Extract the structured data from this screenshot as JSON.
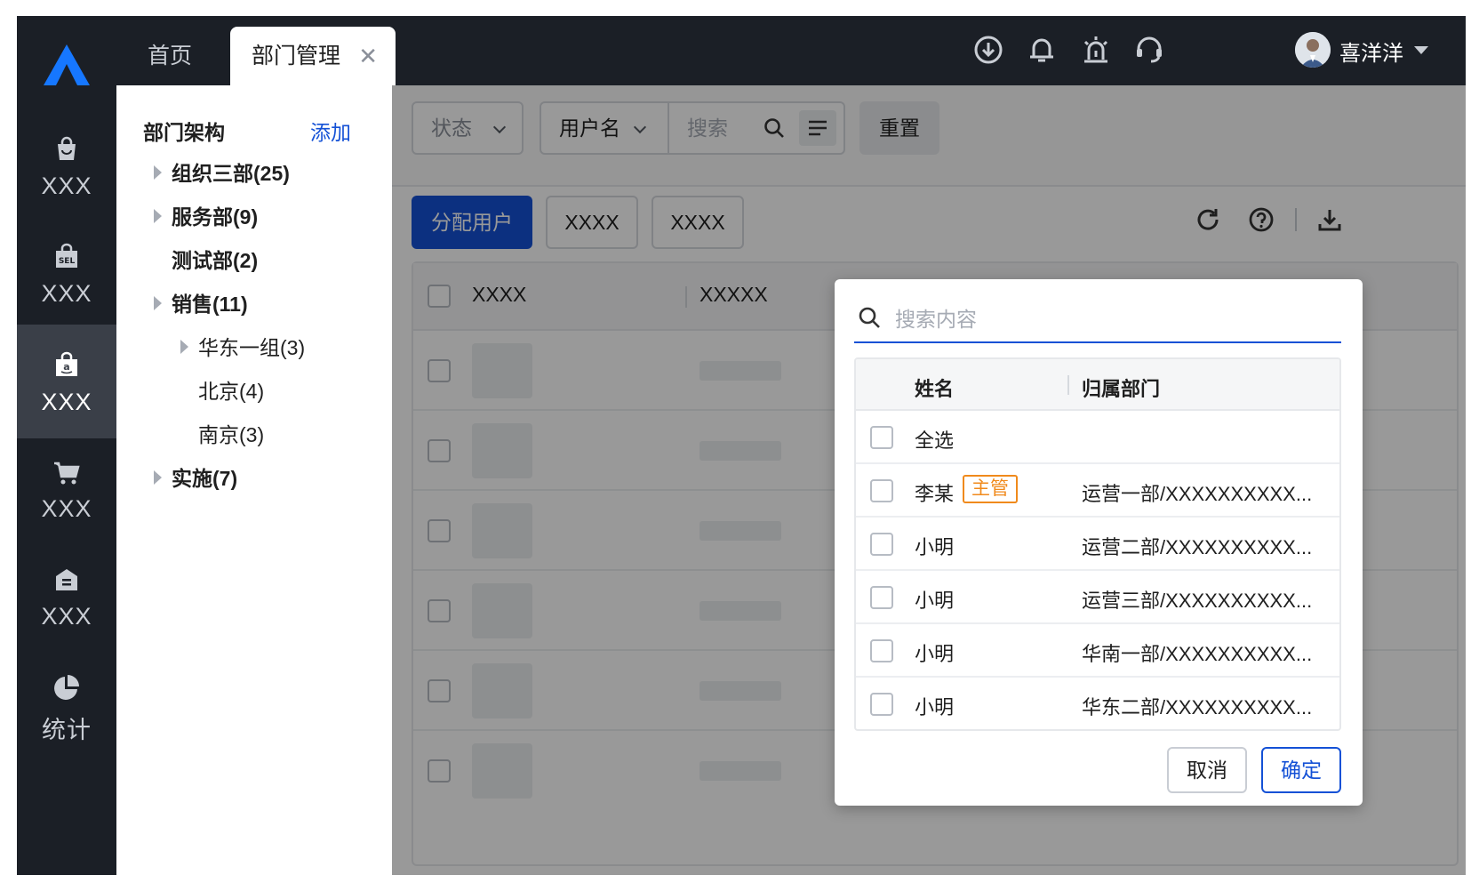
{
  "nav": {
    "items": [
      {
        "label": "XXX",
        "icon": "shopping-bag-icon"
      },
      {
        "label": "XXX",
        "icon": "sel-bag-icon"
      },
      {
        "label": "XXX",
        "icon": "amazon-icon"
      },
      {
        "label": "XXX",
        "icon": "cart-icon"
      },
      {
        "label": "XXX",
        "icon": "store-icon"
      },
      {
        "label": "统计",
        "icon": "pie-chart-icon"
      }
    ],
    "active_index": 2
  },
  "tabs": {
    "home": "首页",
    "dept": "部门管理"
  },
  "header": {
    "username": "喜洋洋"
  },
  "tree": {
    "title": "部门架构",
    "add": "添加",
    "nodes": [
      {
        "label": "组织三部(25)"
      },
      {
        "label": "服务部(9)"
      },
      {
        "label": "测试部(2)"
      },
      {
        "label": "销售(11)"
      },
      {
        "label": "华东一组(3)"
      },
      {
        "label": "北京(4)"
      },
      {
        "label": "南京(3)"
      },
      {
        "label": "实施(7)"
      }
    ]
  },
  "filter": {
    "status": "状态",
    "username": "用户名",
    "search_placeholder": "搜索",
    "reset": "重置"
  },
  "actions": {
    "assign": "分配用户",
    "b1": "XXXX",
    "b2": "XXXX"
  },
  "table": {
    "col1": "XXXX",
    "col2": "XXXXX"
  },
  "popup": {
    "search_placeholder": "搜索内容",
    "col_name": "姓名",
    "col_dept": "归属部门",
    "select_all": "全选",
    "rows": [
      {
        "name": "李某",
        "badge": "主管",
        "dept": "运营一部/XXXXXXXXXX..."
      },
      {
        "name": "小明",
        "dept": "运营二部/XXXXXXXXXX..."
      },
      {
        "name": "小明",
        "dept": "运营三部/XXXXXXXXXX..."
      },
      {
        "name": "小明",
        "dept": "华南一部/XXXXXXXXXX..."
      },
      {
        "name": "小明",
        "dept": "华东二部/XXXXXXXXXX..."
      }
    ],
    "cancel": "取消",
    "confirm": "确定"
  },
  "colors": {
    "accent": "#1451d6",
    "nav_bg": "#1b1f26",
    "badge": "#f08a1c"
  }
}
